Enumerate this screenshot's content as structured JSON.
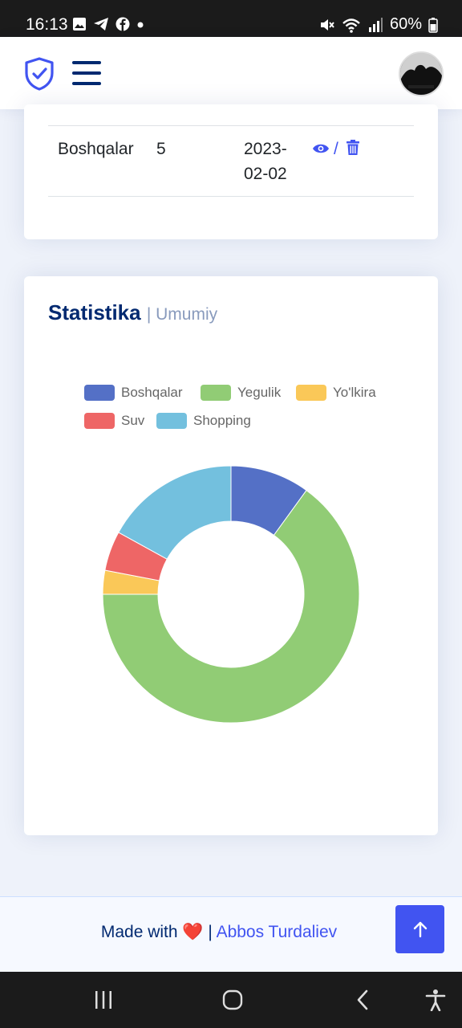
{
  "status_bar": {
    "time": "16:13",
    "battery": "60%"
  },
  "table": {
    "row": {
      "name": "Boshqalar",
      "count": "5",
      "date_line1": "2023-",
      "date_line2": "02-02",
      "separator": "/"
    }
  },
  "stat_card": {
    "title": "Statistika",
    "subtitle": "| Umumiy"
  },
  "chart_data": {
    "type": "pie",
    "variant": "donut",
    "title": "",
    "categories": [
      "Boshqalar",
      "Yegulik",
      "Yo'lkira",
      "Suv",
      "Shopping"
    ],
    "values": [
      10,
      65,
      3,
      5,
      17
    ],
    "colors": [
      "#5470c6",
      "#91cc75",
      "#fac858",
      "#ee6666",
      "#73c0de"
    ],
    "legend_position": "top"
  },
  "footer": {
    "made_with": "Made with",
    "heart": "❤️",
    "separator": "|",
    "author": "Abbos Turdaliev"
  },
  "icons": {
    "logo": "shield-check-icon",
    "menu": "hamburger-menu-icon",
    "view": "eye-icon",
    "delete": "trash-icon",
    "back_to_top": "arrow-up-icon"
  }
}
